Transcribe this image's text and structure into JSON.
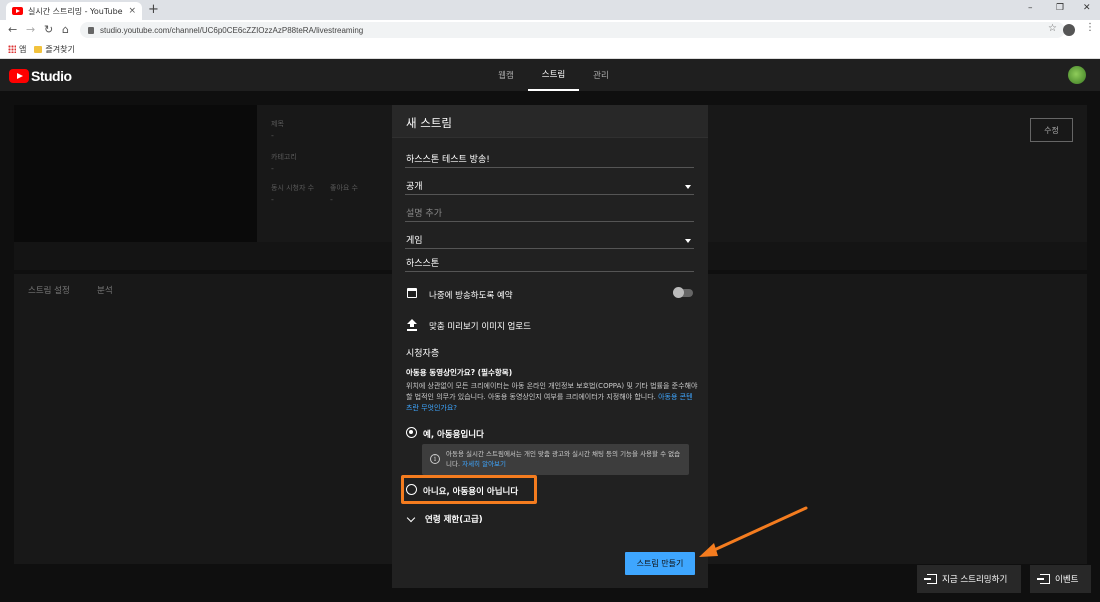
{
  "browser": {
    "tab_title": "실시간 스트리밍 - YouTube Studio",
    "tab_close": "×",
    "new_tab": "+",
    "window_controls": [
      "–",
      "❐",
      "✕"
    ],
    "url": "studio.youtube.com/channel/UC6p0CE6cZZIOzzAzP88teRA/livestreaming",
    "bookmarks": [
      "앱",
      "즐겨찾기"
    ]
  },
  "studio": {
    "logo_text": "Studio",
    "nav": [
      "웹캠",
      "스트림",
      "관리"
    ],
    "active_nav": "스트림"
  },
  "background": {
    "labels": {
      "title": "제목",
      "category": "카테고리",
      "concurrent_viewers": "동시 시청자 수",
      "likes": "좋아요 수"
    },
    "placeholder_value": "-",
    "edit_button": "수정",
    "sub_tabs": [
      "스트림 설정",
      "분석"
    ]
  },
  "modal": {
    "title": "새 스트림",
    "fields": {
      "stream_title": "하스스톤 테스트 방송!",
      "visibility": "공개",
      "description_placeholder": "설명 추가",
      "category": "게임",
      "game_title": "하스스톤"
    },
    "schedule_label": "나중에 방송하도록 예약",
    "schedule_enabled": false,
    "thumbnail_label": "맞춤 미리보기 이미지 업로드",
    "audience_section": "시청자층",
    "kids_question": "아동용 동영상인가요? (필수항목)",
    "kids_desc_main": "위치에 상관없이 모든 크리에이터는 아동 온라인 개인정보 보호법(COPPA) 및 기타 법률을 준수해야 할 법적인 의무가 있습니다. 아동용 동영상인지 여부를 크리에이터가 지정해야 합니다. ",
    "kids_desc_link": "아동용 콘텐츠란 무엇인가요?",
    "option_yes": "예, 아동용입니다",
    "option_no": "아니요, 아동용이 아닙니다",
    "selected_option": "예, 아동용입니다",
    "info_icon": "i",
    "info_main": "아동용 실시간 스트림에서는 개인 맞춤 광고와 실시간 채팅 등의 기능을 사용할 수 없습니다. ",
    "info_link": "자세히 알아보기",
    "age_restriction": "연령 제한(고급)",
    "create_button": "스트림 만들기"
  },
  "bottom_buttons": [
    "지금 스트리밍하기",
    "이벤트"
  ],
  "colors": {
    "accent_blue": "#3ea6ff",
    "highlight_orange": "#f47c1f",
    "youtube_red": "#ff0000"
  }
}
